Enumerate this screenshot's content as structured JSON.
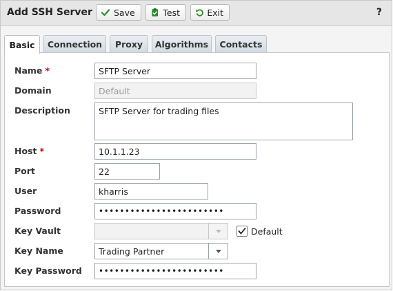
{
  "dialog": {
    "title": "Add SSH Server",
    "help": "?",
    "toolbar": {
      "save_label": "Save",
      "test_label": "Test",
      "exit_label": "Exit"
    },
    "colors": {
      "save_icon": "#2e8b2e",
      "test_icon": "#2e8b2e",
      "exit_icon": "#2e8b2e",
      "required": "#d10000"
    }
  },
  "tabs": [
    {
      "label": "Basic",
      "active": true
    },
    {
      "label": "Connection",
      "active": false
    },
    {
      "label": "Proxy",
      "active": false
    },
    {
      "label": "Algorithms",
      "active": false
    },
    {
      "label": "Contacts",
      "active": false
    }
  ],
  "form": {
    "name": {
      "label": "Name",
      "required_mark": "*",
      "value": "SFTP Server"
    },
    "domain": {
      "label": "Domain",
      "value": "Default",
      "disabled": true
    },
    "description": {
      "label": "Description",
      "value": "SFTP Server for trading files"
    },
    "host": {
      "label": "Host",
      "required_mark": "*",
      "value": "10.1.1.23"
    },
    "port": {
      "label": "Port",
      "value": "22"
    },
    "user": {
      "label": "User",
      "value": "kharris"
    },
    "password": {
      "label": "Password",
      "value": "••••••••••••••••••••••••"
    },
    "key_vault": {
      "label": "Key Vault",
      "value": "",
      "disabled": true,
      "default_label": "Default",
      "default_checked": true
    },
    "key_name": {
      "label": "Key Name",
      "value": "Trading Partner"
    },
    "key_password": {
      "label": "Key Password",
      "value": "••••••••••••••••••••••••"
    }
  }
}
